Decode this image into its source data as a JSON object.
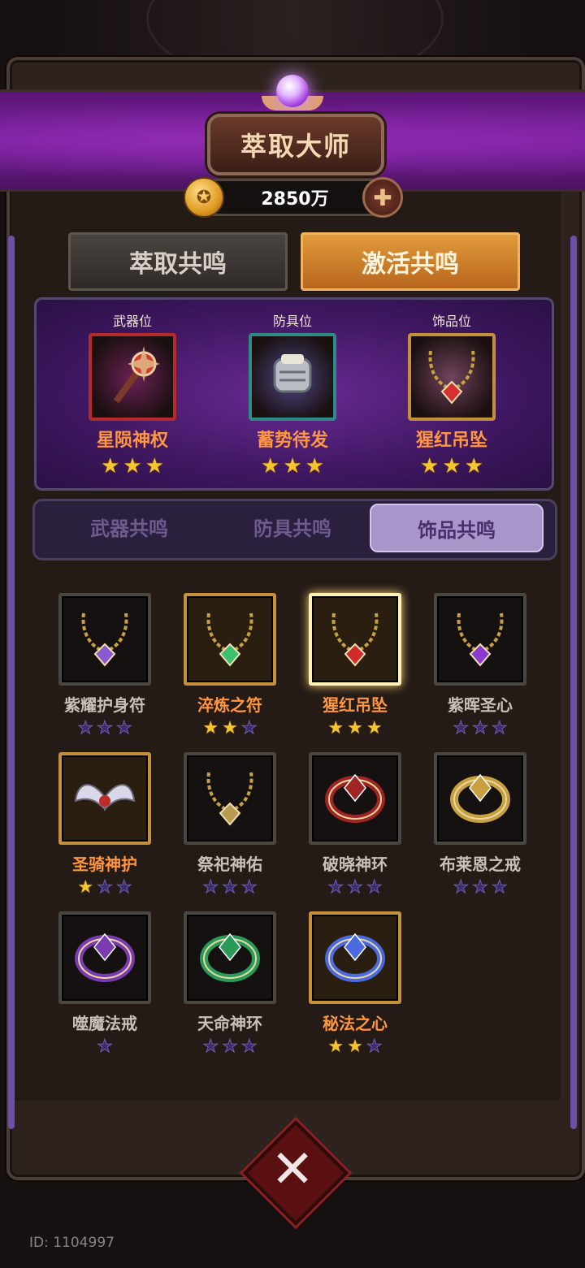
{
  "header": {
    "title": "萃取大师"
  },
  "currency": {
    "value": "2850万"
  },
  "main_tabs": [
    {
      "label": "萃取共鸣",
      "active": false
    },
    {
      "label": "激活共鸣",
      "active": true
    }
  ],
  "equipped": [
    {
      "slot": "武器位",
      "name": "星陨神权",
      "stars": 3,
      "frame_color": "#b52a2a",
      "icon": "scepter-icon"
    },
    {
      "slot": "防具位",
      "name": "蓄势待发",
      "stars": 3,
      "frame_color": "#2f8a84",
      "icon": "gauntlet-icon"
    },
    {
      "slot": "饰品位",
      "name": "猩红吊坠",
      "stars": 3,
      "frame_color": "#c4913a",
      "icon": "pendant-icon"
    }
  ],
  "sub_tabs": [
    {
      "label": "武器共鸣",
      "active": false
    },
    {
      "label": "防具共鸣",
      "active": false
    },
    {
      "label": "饰品共鸣",
      "active": true
    }
  ],
  "items": [
    {
      "name": "紫耀护身符",
      "stars": 0,
      "max": 3,
      "owned": false,
      "selected": false,
      "icon": "amulet-icon",
      "color": "#8a5ad0"
    },
    {
      "name": "淬炼之符",
      "stars": 2,
      "max": 3,
      "owned": true,
      "selected": false,
      "icon": "necklace-icon",
      "color": "#3ac070"
    },
    {
      "name": "猩红吊坠",
      "stars": 3,
      "max": 3,
      "owned": true,
      "selected": true,
      "icon": "pendant-icon",
      "color": "#d02a2a"
    },
    {
      "name": "紫晖圣心",
      "stars": 0,
      "max": 3,
      "owned": false,
      "selected": false,
      "icon": "heart-pendant-icon",
      "color": "#8a3ad0"
    },
    {
      "name": "圣骑神护",
      "stars": 1,
      "max": 3,
      "owned": true,
      "selected": false,
      "icon": "wing-pendant-icon",
      "color": "#d8d8e8"
    },
    {
      "name": "祭祀神佑",
      "stars": 0,
      "max": 3,
      "owned": false,
      "selected": false,
      "icon": "chain-icon",
      "color": "#b89a50"
    },
    {
      "name": "破晓神环",
      "stars": 0,
      "max": 3,
      "owned": false,
      "selected": false,
      "icon": "ring-icon",
      "color": "#a02424"
    },
    {
      "name": "布莱恩之戒",
      "stars": 0,
      "max": 3,
      "owned": false,
      "selected": false,
      "icon": "ring-icon",
      "color": "#c8a040"
    },
    {
      "name": "噬魔法戒",
      "stars": 0,
      "max": 1,
      "owned": false,
      "selected": false,
      "icon": "ring-icon",
      "color": "#7a3ab0"
    },
    {
      "name": "天命神环",
      "stars": 0,
      "max": 3,
      "owned": false,
      "selected": false,
      "icon": "ring-icon",
      "color": "#2a9a5a"
    },
    {
      "name": "秘法之心",
      "stars": 2,
      "max": 3,
      "owned": true,
      "selected": false,
      "icon": "ring-icon",
      "color": "#4a6ae0"
    }
  ],
  "footer": {
    "user_id": "ID: 1104997"
  }
}
